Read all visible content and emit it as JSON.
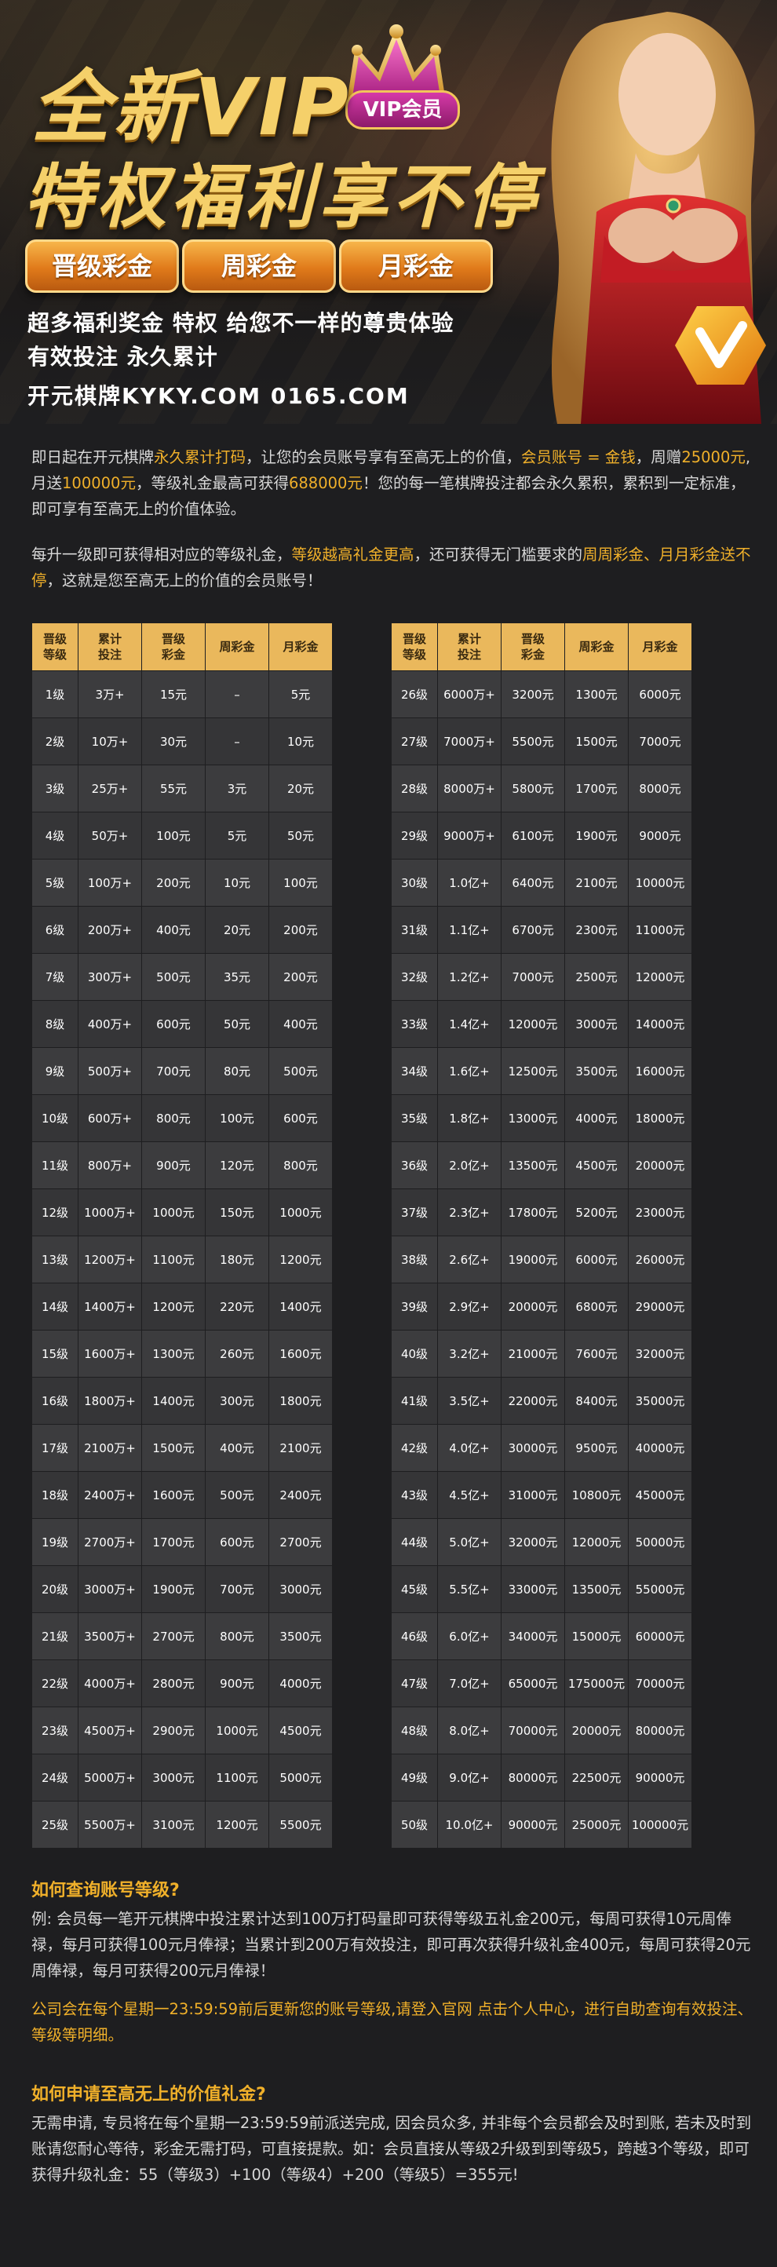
{
  "hero": {
    "title_line1": "全新VIP",
    "title_line2": "特权福利享不停",
    "vip_badge": "VIP会员",
    "pills": [
      "晋级彩金",
      "周彩金",
      "月彩金"
    ],
    "sub1": "超多福利奖金  特权 给您不一样的尊贵体验",
    "sub2": "有效投注  永久累计",
    "sub3": "开元棋牌KYKY.COM  0165.COM"
  },
  "intro": {
    "p1_a": "即日起在开元棋牌",
    "p1_b": "永久累计打码",
    "p1_c": "，让您的会员账号享有至高无上的价值，",
    "p1_d": "会员账号 = 金钱",
    "p1_e": "，周赠",
    "p1_f": "25000元",
    "p1_g": ",月送",
    "p1_h": "100000元",
    "p1_i": "，等级礼金最高可获得",
    "p1_j": "688000元",
    "p1_k": "！您的每一笔棋牌投注都会永久累积，累积到一定标准，即可享有至高无上的价值体验。",
    "p2_a": "每升一级即可获得相对应的等级礼金，",
    "p2_b": "等级越高礼金更高",
    "p2_c": "，还可获得无门槛要求的",
    "p2_d": "周周彩金、月月彩金送不停",
    "p2_e": "，这就是您至高无上的价值的会员账号！"
  },
  "table": {
    "headers": [
      "晋级\n等级",
      "累计\n投注",
      "晋级\n彩金",
      "周彩金",
      "月彩金"
    ],
    "left_rows": [
      [
        "1级",
        "3万+",
        "15元",
        "–",
        "5元"
      ],
      [
        "2级",
        "10万+",
        "30元",
        "–",
        "10元"
      ],
      [
        "3级",
        "25万+",
        "55元",
        "3元",
        "20元"
      ],
      [
        "4级",
        "50万+",
        "100元",
        "5元",
        "50元"
      ],
      [
        "5级",
        "100万+",
        "200元",
        "10元",
        "100元"
      ],
      [
        "6级",
        "200万+",
        "400元",
        "20元",
        "200元"
      ],
      [
        "7级",
        "300万+",
        "500元",
        "35元",
        "200元"
      ],
      [
        "8级",
        "400万+",
        "600元",
        "50元",
        "400元"
      ],
      [
        "9级",
        "500万+",
        "700元",
        "80元",
        "500元"
      ],
      [
        "10级",
        "600万+",
        "800元",
        "100元",
        "600元"
      ],
      [
        "11级",
        "800万+",
        "900元",
        "120元",
        "800元"
      ],
      [
        "12级",
        "1000万+",
        "1000元",
        "150元",
        "1000元"
      ],
      [
        "13级",
        "1200万+",
        "1100元",
        "180元",
        "1200元"
      ],
      [
        "14级",
        "1400万+",
        "1200元",
        "220元",
        "1400元"
      ],
      [
        "15级",
        "1600万+",
        "1300元",
        "260元",
        "1600元"
      ],
      [
        "16级",
        "1800万+",
        "1400元",
        "300元",
        "1800元"
      ],
      [
        "17级",
        "2100万+",
        "1500元",
        "400元",
        "2100元"
      ],
      [
        "18级",
        "2400万+",
        "1600元",
        "500元",
        "2400元"
      ],
      [
        "19级",
        "2700万+",
        "1700元",
        "600元",
        "2700元"
      ],
      [
        "20级",
        "3000万+",
        "1900元",
        "700元",
        "3000元"
      ],
      [
        "21级",
        "3500万+",
        "2700元",
        "800元",
        "3500元"
      ],
      [
        "22级",
        "4000万+",
        "2800元",
        "900元",
        "4000元"
      ],
      [
        "23级",
        "4500万+",
        "2900元",
        "1000元",
        "4500元"
      ],
      [
        "24级",
        "5000万+",
        "3000元",
        "1100元",
        "5000元"
      ],
      [
        "25级",
        "5500万+",
        "3100元",
        "1200元",
        "5500元"
      ]
    ],
    "right_rows": [
      [
        "26级",
        "6000万+",
        "3200元",
        "1300元",
        "6000元"
      ],
      [
        "27级",
        "7000万+",
        "5500元",
        "1500元",
        "7000元"
      ],
      [
        "28级",
        "8000万+",
        "5800元",
        "1700元",
        "8000元"
      ],
      [
        "29级",
        "9000万+",
        "6100元",
        "1900元",
        "9000元"
      ],
      [
        "30级",
        "1.0亿+",
        "6400元",
        "2100元",
        "10000元"
      ],
      [
        "31级",
        "1.1亿+",
        "6700元",
        "2300元",
        "11000元"
      ],
      [
        "32级",
        "1.2亿+",
        "7000元",
        "2500元",
        "12000元"
      ],
      [
        "33级",
        "1.4亿+",
        "12000元",
        "3000元",
        "14000元"
      ],
      [
        "34级",
        "1.6亿+",
        "12500元",
        "3500元",
        "16000元"
      ],
      [
        "35级",
        "1.8亿+",
        "13000元",
        "4000元",
        "18000元"
      ],
      [
        "36级",
        "2.0亿+",
        "13500元",
        "4500元",
        "20000元"
      ],
      [
        "37级",
        "2.3亿+",
        "17800元",
        "5200元",
        "23000元"
      ],
      [
        "38级",
        "2.6亿+",
        "19000元",
        "6000元",
        "26000元"
      ],
      [
        "39级",
        "2.9亿+",
        "20000元",
        "6800元",
        "29000元"
      ],
      [
        "40级",
        "3.2亿+",
        "21000元",
        "7600元",
        "32000元"
      ],
      [
        "41级",
        "3.5亿+",
        "22000元",
        "8400元",
        "35000元"
      ],
      [
        "42级",
        "4.0亿+",
        "30000元",
        "9500元",
        "40000元"
      ],
      [
        "43级",
        "4.5亿+",
        "31000元",
        "10800元",
        "45000元"
      ],
      [
        "44级",
        "5.0亿+",
        "32000元",
        "12000元",
        "50000元"
      ],
      [
        "45级",
        "5.5亿+",
        "33000元",
        "13500元",
        "55000元"
      ],
      [
        "46级",
        "6.0亿+",
        "34000元",
        "15000元",
        "60000元"
      ],
      [
        "47级",
        "7.0亿+",
        "65000元",
        "175000元",
        "70000元"
      ],
      [
        "48级",
        "8.0亿+",
        "70000元",
        "20000元",
        "80000元"
      ],
      [
        "49级",
        "9.0亿+",
        "80000元",
        "22500元",
        "90000元"
      ],
      [
        "50级",
        "10.0亿+",
        "90000元",
        "25000元",
        "100000元"
      ]
    ]
  },
  "faq": {
    "q1": "如何查询账号等级?",
    "a1": "例: 会员每一笔开元棋牌中投注累计达到100万打码量即可获得等级五礼金200元，每周可获得10元周俸禄，每月可获得100元月俸禄；当累计到200万有效投注，即可再次获得升级礼金400元，每周可获得20元周俸禄，每月可获得200元月俸禄！",
    "a1b": "公司会在每个星期一23:59:59前后更新您的账号等级,请登入官网 点击个人中心，进行自助查询有效投注、等级等明细。",
    "q2": "如何申请至高无上的价值礼金?",
    "a2": "无需申请, 专员将在每个星期一23:59:59前派送完成, 因会员众多, 并非每个会员都会及时到账, 若未及时到账请您耐心等待，彩金无需打码，可直接提款。如：会员直接从等级2升级到到等级5，跨越3个等级，即可获得升级礼金：55（等级3）+100（等级4）+200（等级5）=355元!"
  }
}
